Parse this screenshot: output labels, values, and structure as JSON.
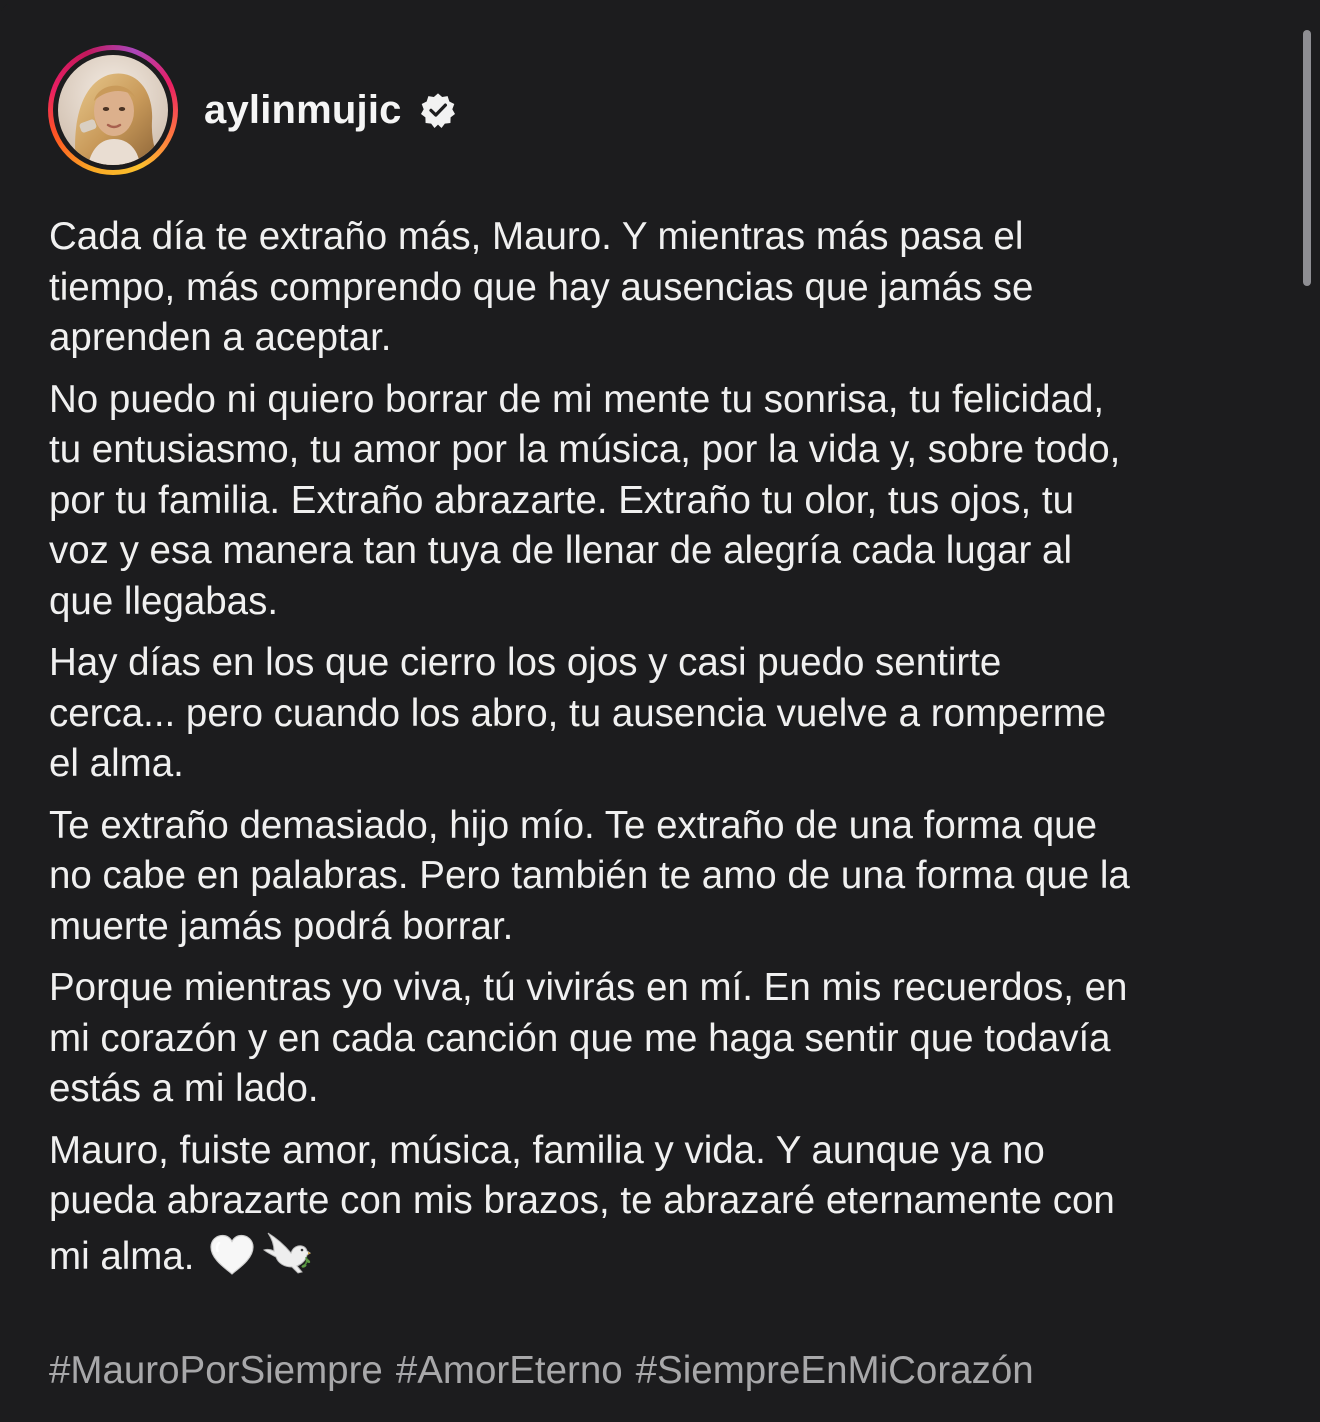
{
  "header": {
    "username": "aylinmujic",
    "verified": true,
    "avatar_icon": "profile-photo"
  },
  "caption": {
    "paragraphs": [
      "Cada día te extraño más, Mauro. Y mientras más pasa el\ntiempo, más comprendo que hay ausencias que jamás se\naprenden a aceptar.",
      "No puedo ni quiero borrar de mi mente tu sonrisa, tu felicidad,\ntu entusiasmo, tu amor por la música, por la vida y, sobre todo,\npor tu familia. Extraño abrazarte. Extraño tu olor, tus ojos, tu\nvoz y esa manera tan tuya de llenar de alegría cada lugar al\nque llegabas.",
      "Hay días en los que cierro los ojos y casi puedo sentirte\ncerca... pero cuando los abro, tu ausencia vuelve a romperme\nel alma.",
      "Te extraño demasiado, hijo mío. Te extraño de una forma que\nno cabe en palabras. Pero también te amo de una forma que la\nmuerte jamás podrá borrar.",
      "Porque mientras yo viva, tú vivirás en mí. En mis recuerdos, en\nmi corazón y en cada canción que me haga sentir que todavía\nestás a mi lado.",
      "Mauro, fuiste amor, música, familia y vida. Y aunque ya no\npueda abrazarte con mis brazos, te abrazaré eternamente con\nmi alma."
    ],
    "trailing_emojis": [
      "white-heart",
      "dove"
    ]
  },
  "hashtags": [
    "#MauroPorSiempre",
    "#AmorEterno",
    "#SiempreEnMiCorazón"
  ],
  "colors": {
    "background": "#1c1c1e",
    "text": "#f0f0f0",
    "hashtag": "#a8a8aa"
  }
}
